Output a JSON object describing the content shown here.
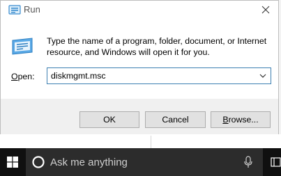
{
  "window": {
    "title": "Run",
    "description": "Type the name of a program, folder, document, or Internet resource, and Windows will open it for you.",
    "close_icon": "close-icon",
    "app_icon": "run-icon"
  },
  "open_field": {
    "label_accel": "O",
    "label_rest": "pen:",
    "value": "diskmgmt.msc",
    "dropdown_icon": "chevron-down-icon"
  },
  "buttons": {
    "ok": "OK",
    "cancel": "Cancel",
    "browse_accel": "B",
    "browse_rest": "rowse..."
  },
  "taskbar": {
    "start_icon": "windows-logo-icon",
    "search_placeholder": "Ask me anything",
    "cortana_icon": "cortana-icon",
    "mic_icon": "microphone-icon",
    "task_view_icon": "task-view-icon"
  },
  "colors": {
    "accent_border": "#3c7fb1",
    "taskbar_bg": "#101010",
    "search_bg": "#2c2c2c",
    "button_bg": "#e1e1e1",
    "footer_bg": "#f0f0f0"
  }
}
